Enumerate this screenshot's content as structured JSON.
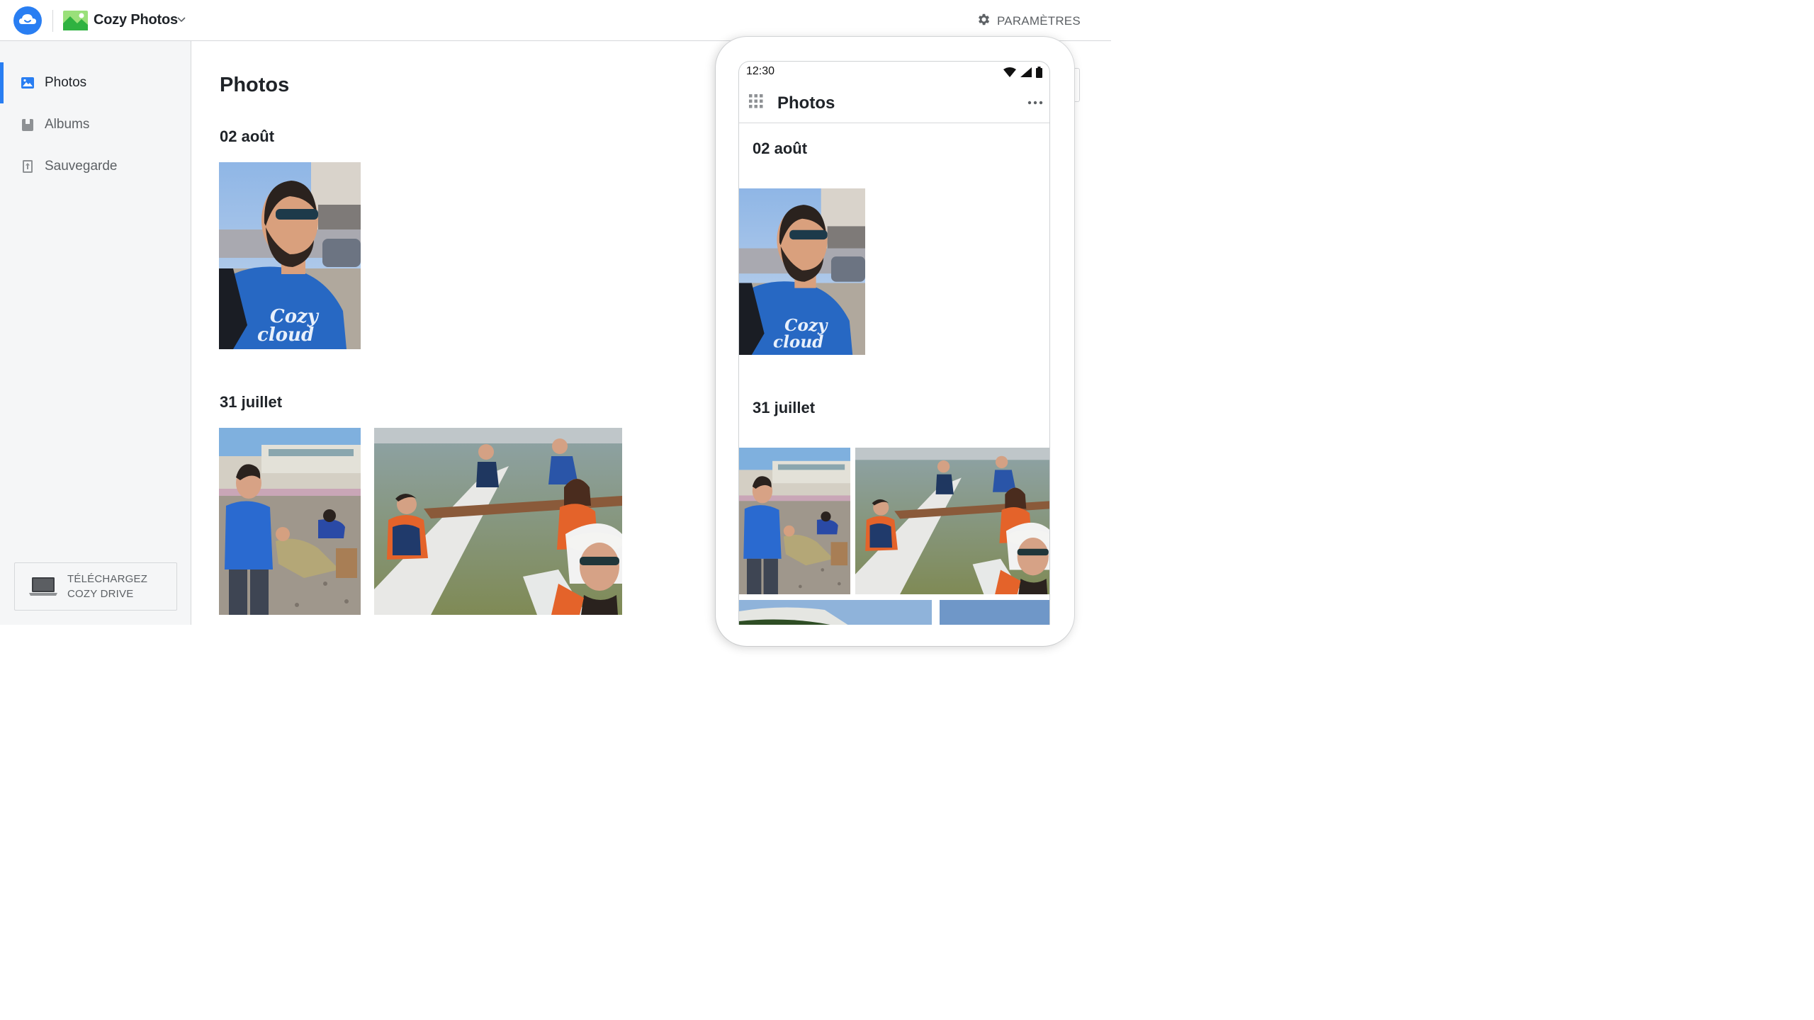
{
  "app": {
    "name": "Cozy Photos",
    "cloud_icon": "cozy-cloud-icon",
    "app_icon": "photos-app-icon",
    "chevron_icon": "chevron-down-icon"
  },
  "header": {
    "settings_label": "PARAMÈTRES",
    "settings_icon": "gear-icon"
  },
  "sidebar": {
    "items": [
      {
        "label": "Photos",
        "icon": "image-icon",
        "active": true
      },
      {
        "label": "Albums",
        "icon": "album-icon",
        "active": false
      },
      {
        "label": "Sauvegarde",
        "icon": "backup-icon",
        "active": false
      }
    ],
    "download": {
      "line1": "TÉLÉCHARGEZ",
      "line2": "COZY DRIVE",
      "icon": "laptop-icon"
    }
  },
  "main": {
    "title": "Photos",
    "sections": [
      {
        "date": "02 août"
      },
      {
        "date": "31 juillet"
      }
    ]
  },
  "mobile": {
    "time": "12:30",
    "title": "Photos",
    "sections": [
      {
        "date": "02 août"
      },
      {
        "date": "31 juillet"
      }
    ]
  },
  "colors": {
    "accent": "#297ef2",
    "sidebar_bg": "#f5f6f7",
    "text": "#1f2328",
    "muted": "#5d6165",
    "border": "#d6d8da"
  }
}
